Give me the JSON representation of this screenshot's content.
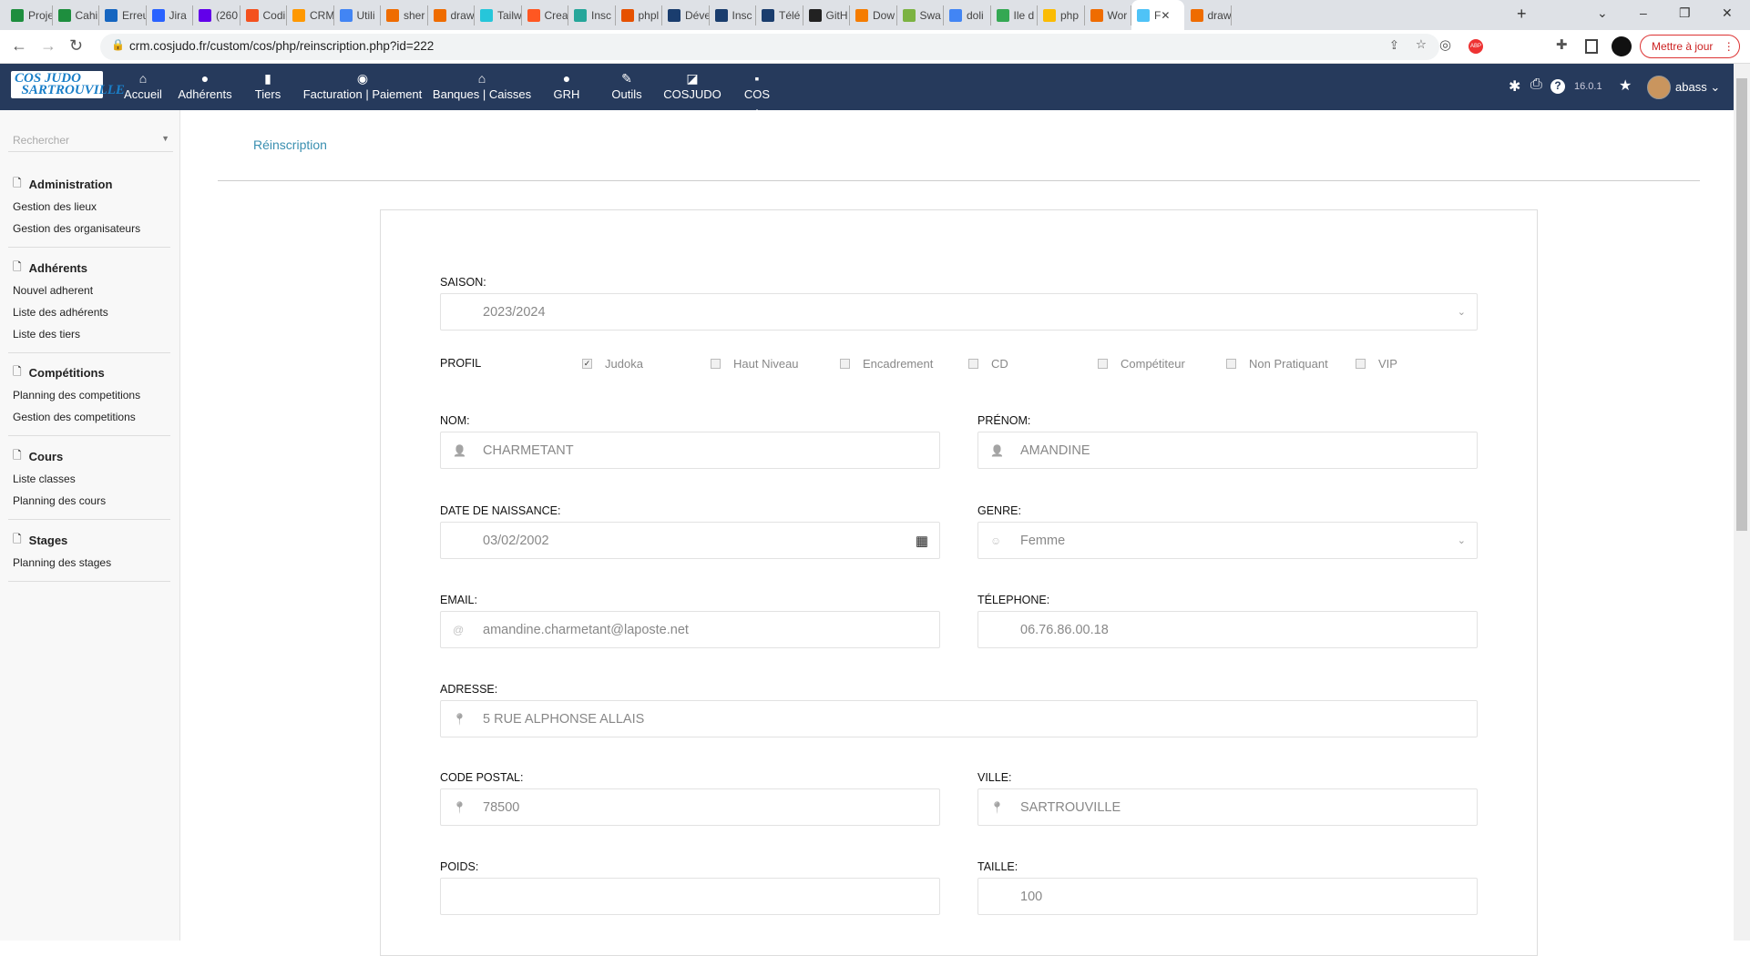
{
  "browser": {
    "tabs": [
      "Proje",
      "Cahi",
      "Erreu",
      "Jira",
      "(260",
      "Codi",
      "CRM",
      "Utili",
      "sher",
      "draw",
      "Tailw",
      "Crea",
      "Insc",
      "phpl",
      "Déve",
      "Insc",
      "Télé",
      "GitH",
      "Dow",
      "Swa",
      "doli",
      "Ile d",
      "php",
      "Wor",
      "F",
      "draw"
    ],
    "active_tab": 24,
    "url": "crm.cosjudo.fr/custom/cos/php/reinscription.php?id=222",
    "update_label": "Mettre à jour"
  },
  "nav": {
    "logo": "COS JUDO SARTROUVILLE",
    "items": [
      {
        "label": "Accueil",
        "icon": "home-icon"
      },
      {
        "label": "Adhérents",
        "icon": "user-icon"
      },
      {
        "label": "Tiers",
        "icon": "building-icon"
      },
      {
        "label": "Facturation | Paiement",
        "icon": "coins-icon"
      },
      {
        "label": "Banques | Caisses",
        "icon": "bank-icon"
      },
      {
        "label": "GRH",
        "icon": "user-tie-icon"
      },
      {
        "label": "Outils",
        "icon": "wrench-icon"
      },
      {
        "label": "COSJUDO",
        "icon": "external-icon"
      },
      {
        "label": "COS",
        "icon": "note-icon"
      }
    ],
    "version": "16.0.1",
    "user": "abass"
  },
  "sidebar": {
    "search_placeholder": "Rechercher",
    "groups": [
      {
        "title": "Administration",
        "items": [
          "Gestion des lieux",
          "Gestion des organisateurs"
        ]
      },
      {
        "title": "Adhérents",
        "items": [
          "Nouvel adherent",
          "Liste des adhérents",
          "Liste des tiers"
        ]
      },
      {
        "title": "Compétitions",
        "items": [
          "Planning des competitions",
          "Gestion des competitions"
        ]
      },
      {
        "title": "Cours",
        "items": [
          "Liste classes",
          "Planning des cours"
        ]
      },
      {
        "title": "Stages",
        "items": [
          "Planning des stages"
        ]
      }
    ]
  },
  "page": {
    "title": "Réinscription"
  },
  "form": {
    "saison": {
      "label": "SAISON:",
      "value": "2023/2024"
    },
    "profil": {
      "label": "PROFIL",
      "options": [
        {
          "label": "Judoka",
          "checked": true
        },
        {
          "label": "Haut Niveau",
          "checked": false
        },
        {
          "label": "Encadrement",
          "checked": false
        },
        {
          "label": "CD",
          "checked": false
        },
        {
          "label": "Compétiteur",
          "checked": false
        },
        {
          "label": "Non Pratiquant",
          "checked": false
        },
        {
          "label": "VIP",
          "checked": false
        }
      ]
    },
    "nom": {
      "label": "NOM:",
      "value": "CHARMETANT"
    },
    "prenom": {
      "label": "PRÉNOM:",
      "value": "AMANDINE"
    },
    "naissance": {
      "label": "DATE DE NAISSANCE:",
      "value": "03/02/2002"
    },
    "genre": {
      "label": "GENRE:",
      "value": "Femme"
    },
    "email": {
      "label": "EMAIL:",
      "value": "amandine.charmetant@laposte.net"
    },
    "telephone": {
      "label": "TÉLEPHONE:",
      "value": "06.76.86.00.18"
    },
    "adresse": {
      "label": "ADRESSE:",
      "value": "5 RUE ALPHONSE ALLAIS"
    },
    "code_postal": {
      "label": "CODE POSTAL:",
      "value": "78500"
    },
    "ville": {
      "label": "VILLE:",
      "value": "SARTROUVILLE"
    },
    "poids": {
      "label": "POIDS:",
      "value": ""
    },
    "taille": {
      "label": "TAILLE:",
      "value": "100"
    }
  }
}
